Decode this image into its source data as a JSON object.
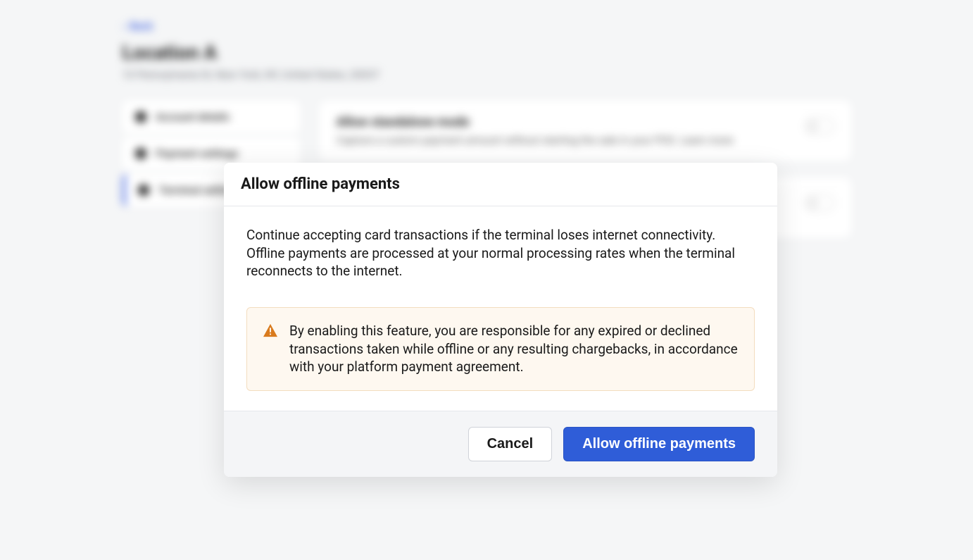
{
  "back_link": "Back",
  "page_title": "Location A",
  "page_subtitle": "10 Pennsylvania St, New York, NY, United States, 20037",
  "sidebar": {
    "items": [
      {
        "label": "Account details"
      },
      {
        "label": "Payment settings"
      },
      {
        "label": "Terminal settings"
      }
    ]
  },
  "cards": [
    {
      "title": "Allow standalone mode",
      "desc": "Capture a custom payment amount without starting the sale in your POS. Learn more",
      "link": "Learn more"
    },
    {
      "title": "",
      "desc": ""
    }
  ],
  "modal": {
    "title": "Allow offline payments",
    "description": "Continue accepting card transactions if the terminal loses internet connectivity. Offline payments are processed at your normal processing rates when the terminal reconnects to the internet.",
    "warning": "By enabling this feature, you are responsible for any expired or declined transactions taken while offline or any resulting chargebacks, in accordance with your platform payment agreement.",
    "cancel_label": "Cancel",
    "confirm_label": "Allow offline payments"
  }
}
